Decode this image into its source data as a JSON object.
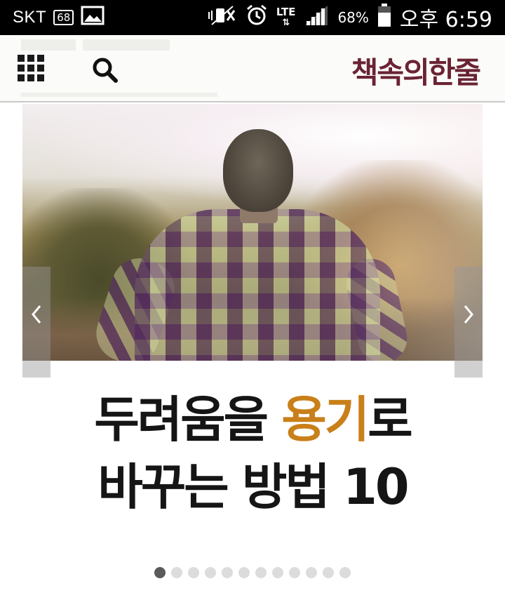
{
  "status_bar": {
    "carrier": "SKT",
    "message_badge": "68",
    "network": "LTE",
    "battery": "68%",
    "time": "오후 6:59",
    "icons": [
      "message-icon",
      "gallery-icon",
      "mute-icon",
      "alarm-icon",
      "lte-icon",
      "signal-icon",
      "battery-icon"
    ]
  },
  "header": {
    "menu_icon": "grid-menu-icon",
    "search_icon": "search-icon",
    "brand": "책속의한줄",
    "brand_color": "#6a2333"
  },
  "carousel": {
    "image_alt": "",
    "prev_icon": "chevron-left-icon",
    "next_icon": "chevron-right-icon",
    "title_line1_a": "두려움을 ",
    "title_line1_accent": "용기",
    "title_line1_b": "로",
    "title_line2": "바꾸는 방법 10",
    "accent_color": "#c9801a",
    "slide_count": 12,
    "active_slide": 1
  }
}
